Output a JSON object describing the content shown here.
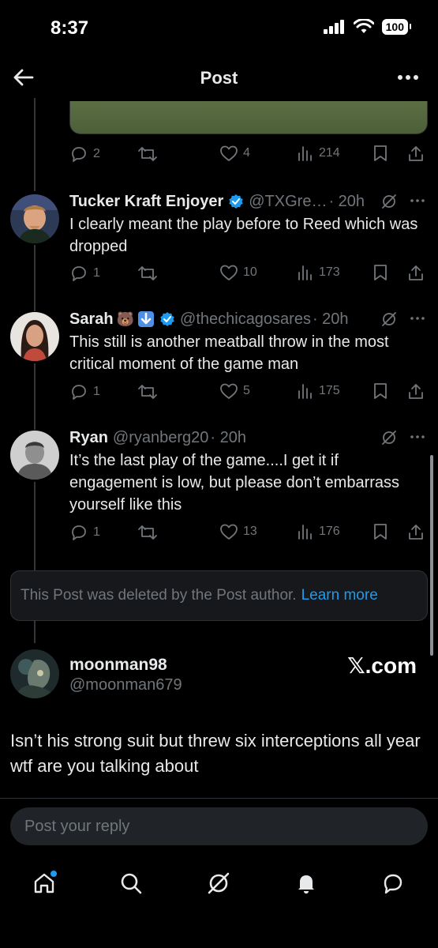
{
  "status_bar": {
    "time": "8:37",
    "battery": "100"
  },
  "header": {
    "title": "Post"
  },
  "top_post_actions": {
    "replies": "2",
    "reposts": "",
    "likes": "4",
    "views": "214"
  },
  "replies": [
    {
      "name": "Tucker Kraft Enjoyer",
      "handle": "@TXGre…",
      "time": "· 20h",
      "verified": true,
      "text": "I clearly meant the play before to Reed which was dropped",
      "stats": {
        "replies": "1",
        "reposts": "",
        "likes": "10",
        "views": "173"
      }
    },
    {
      "name": "Sarah",
      "handle": "@thechicagosares",
      "time": "· 20h",
      "verified": true,
      "emoji": "🐻",
      "text": "This still is another meatball throw in the most critical moment of the game man",
      "stats": {
        "replies": "1",
        "reposts": "",
        "likes": "5",
        "views": "175"
      }
    },
    {
      "name": "Ryan",
      "handle": "@ryanberg20",
      "time": "· 20h",
      "verified": false,
      "text": "It’s the last play of the game....I get it if engagement is low, but please don’t embarrass yourself like this",
      "stats": {
        "replies": "1",
        "reposts": "",
        "likes": "13",
        "views": "176"
      }
    }
  ],
  "deleted_notice": {
    "text": "This Post was deleted by the Post author.",
    "link": "Learn more"
  },
  "main_post": {
    "name": "moonman98",
    "handle": "@moonman679",
    "watermark": "𝕏.com",
    "text": "Isn’t his strong suit but threw six interceptions all year wtf are you talking about"
  },
  "composer": {
    "placeholder": "Post your reply"
  },
  "colors": {
    "background": "#000000",
    "accent": "#1d9bf0",
    "muted": "#71767b"
  },
  "tabs": [
    "home-icon",
    "search-icon",
    "grok-icon",
    "notifications-icon",
    "messages-icon"
  ]
}
